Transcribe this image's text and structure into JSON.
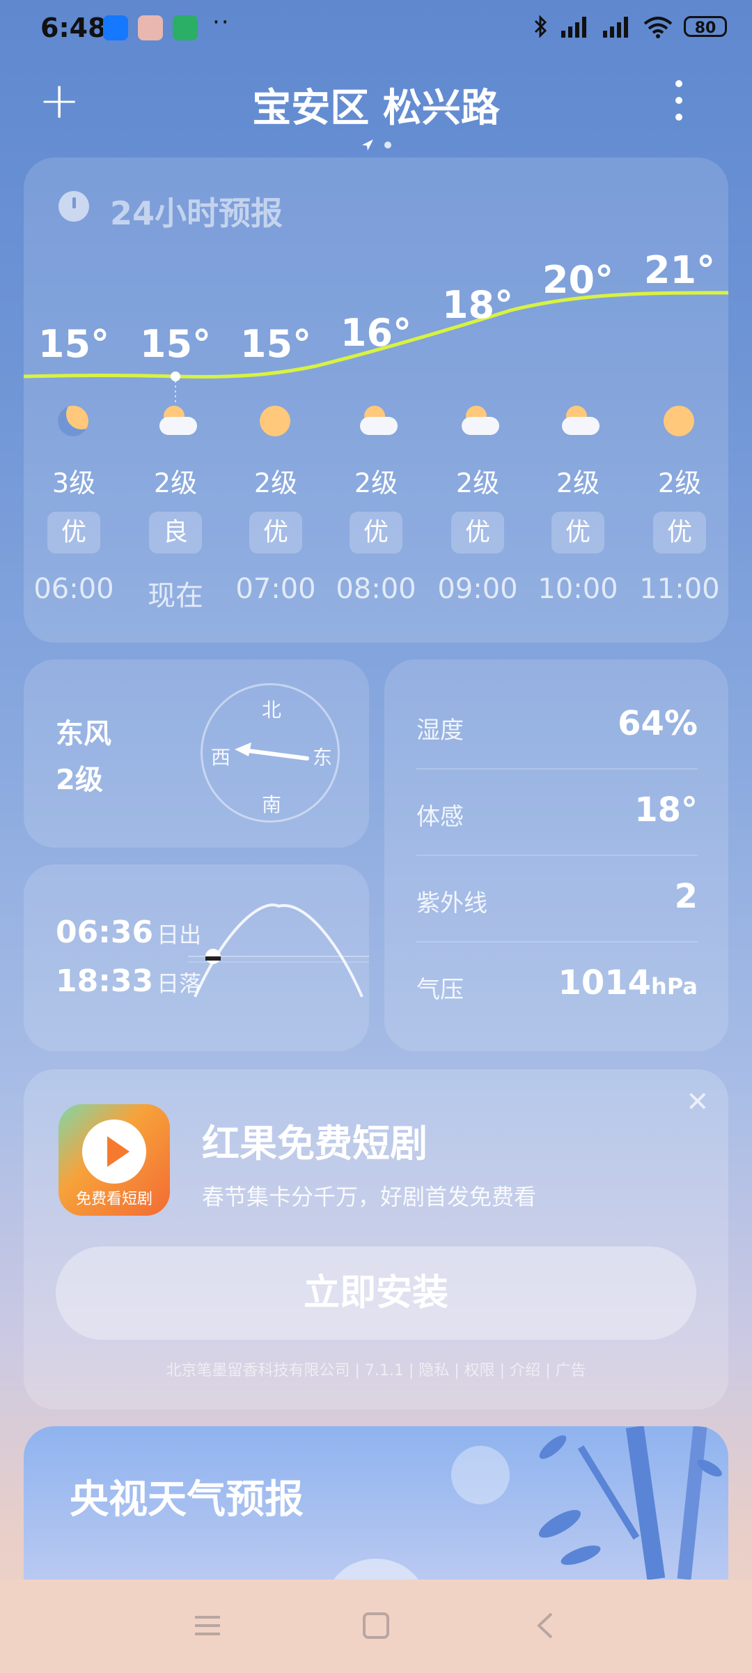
{
  "status_bar": {
    "time": "6:48",
    "more_indicator": "··",
    "battery": "80"
  },
  "header": {
    "add_label": "+",
    "location": "宝安区 松兴路"
  },
  "hourly": {
    "title": "24小时预报",
    "items": [
      {
        "temp": "15°",
        "icon": "moon-icon",
        "wind": "3级",
        "aqi": "优",
        "time": "06:00"
      },
      {
        "temp": "15°",
        "icon": "partly-cloudy-icon",
        "wind": "2级",
        "aqi": "良",
        "time": "现在"
      },
      {
        "temp": "15°",
        "icon": "sun-icon",
        "wind": "2级",
        "aqi": "优",
        "time": "07:00"
      },
      {
        "temp": "16°",
        "icon": "partly-cloudy-icon",
        "wind": "2级",
        "aqi": "优",
        "time": "08:00"
      },
      {
        "temp": "18°",
        "icon": "partly-cloudy-icon",
        "wind": "2级",
        "aqi": "优",
        "time": "09:00"
      },
      {
        "temp": "20°",
        "icon": "partly-cloudy-icon",
        "wind": "2级",
        "aqi": "优",
        "time": "10:00"
      },
      {
        "temp": "21°",
        "icon": "sun-icon",
        "wind": "2级",
        "aqi": "优",
        "time": "11:00"
      }
    ]
  },
  "wind": {
    "direction": "东风",
    "level": "2级",
    "compass": {
      "north": "北",
      "south": "南",
      "east": "东",
      "west": "西"
    }
  },
  "details": {
    "humidity_label": "湿度",
    "humidity_value": "64%",
    "feels_label": "体感",
    "feels_value": "18°",
    "uv_label": "紫外线",
    "uv_value": "2",
    "pressure_label": "气压",
    "pressure_value": "1014",
    "pressure_unit": "hPa"
  },
  "sun": {
    "sunrise_time": "06:36",
    "sunrise_label": "日出",
    "sunset_time": "18:33",
    "sunset_label": "日落"
  },
  "ad": {
    "icon_caption": "免费看短剧",
    "title": "红果免费短剧",
    "subtitle": "春节集卡分千万，好剧首发免费看",
    "install_label": "立即安装",
    "footer": "北京笔墨留香科技有限公司 | 7.1.1 | 隐私 | 权限 | 介绍 | 广告"
  },
  "cctv": {
    "title": "央视天气预报"
  },
  "colors": {
    "temp_curve": "#d9f240",
    "sun_icon": "#ffc87a"
  }
}
